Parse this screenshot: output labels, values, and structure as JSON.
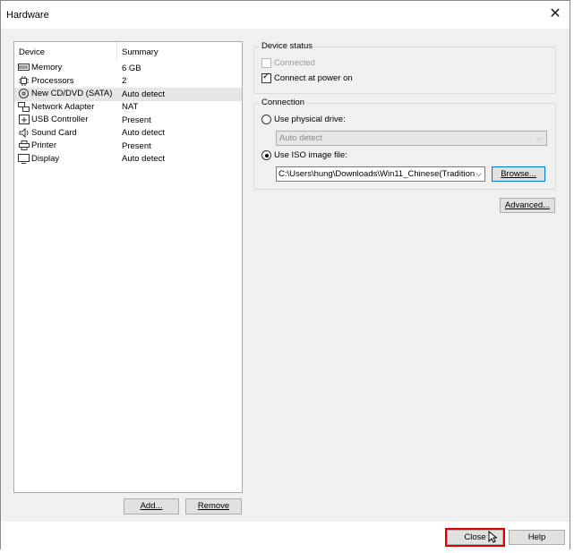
{
  "window": {
    "title": "Hardware",
    "close_glyph": "✕"
  },
  "device_list": {
    "headers": {
      "device": "Device",
      "summary": "Summary"
    },
    "rows": [
      {
        "icon": "memory-icon",
        "name": "Memory",
        "summary": "6 GB"
      },
      {
        "icon": "processor-icon",
        "name": "Processors",
        "summary": "2"
      },
      {
        "icon": "cd-dvd-icon",
        "name": "New CD/DVD (SATA)",
        "summary": "Auto detect",
        "selected": true
      },
      {
        "icon": "network-adapter-icon",
        "name": "Network Adapter",
        "summary": "NAT"
      },
      {
        "icon": "usb-icon",
        "name": "USB Controller",
        "summary": "Present"
      },
      {
        "icon": "sound-card-icon",
        "name": "Sound Card",
        "summary": "Auto detect"
      },
      {
        "icon": "printer-icon",
        "name": "Printer",
        "summary": "Present"
      },
      {
        "icon": "display-icon",
        "name": "Display",
        "summary": "Auto detect"
      }
    ],
    "add_label": "Add...",
    "remove_label": "Remove"
  },
  "device_status": {
    "title": "Device status",
    "connected_label": "Connected",
    "connected_checked": false,
    "connected_enabled": false,
    "power_on_label": "Connect at power on",
    "power_on_checked": true
  },
  "connection": {
    "title": "Connection",
    "physical_label": "Use physical drive:",
    "physical_selected": false,
    "physical_value": "Auto detect",
    "iso_label": "Use ISO image file:",
    "iso_selected": true,
    "iso_path": "C:\\Users\\hung\\Downloads\\Win11_Chinese(Tradition",
    "browse_label": "Browse..."
  },
  "advanced_label": "Advanced...",
  "footer": {
    "close_label": "Close",
    "help_label": "Help"
  },
  "colors": {
    "highlight": "#e00000",
    "selected_row": "#e6e6e6"
  }
}
